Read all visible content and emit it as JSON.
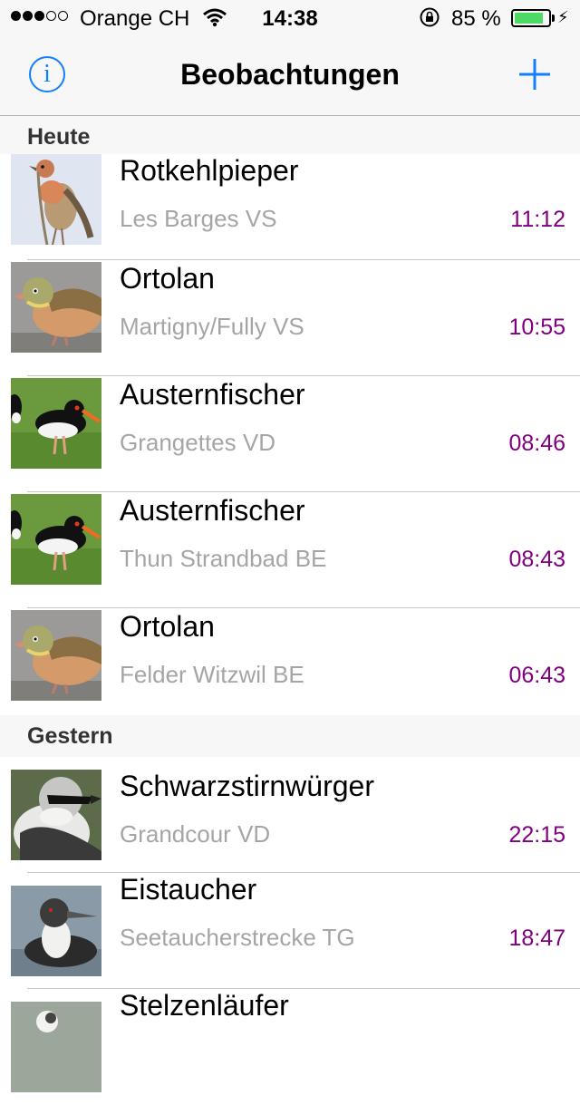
{
  "status_bar": {
    "carrier": "Orange CH",
    "time": "14:38",
    "battery_percent": "85 %",
    "battery_level": 0.85,
    "signal_bars_filled": 3,
    "signal_bars_total": 5,
    "icons": [
      "signal-dots-icon",
      "wifi-icon",
      "rotation-lock-icon",
      "battery-icon",
      "charging-bolt-icon"
    ]
  },
  "nav": {
    "title": "Beobachtungen",
    "info_icon": "info-icon",
    "info_glyph": "i",
    "add_icon": "plus-icon"
  },
  "colors": {
    "accent_blue": "#147efb",
    "time_purple": "#800080",
    "location_gray": "#a5a5a5",
    "battery_green": "#4cd964",
    "header_bg": "#f7f7f7"
  },
  "sections": [
    {
      "title": "Heute",
      "rows": [
        {
          "species": "Rotkehlpieper",
          "location": "Les Barges VS",
          "time": "11:12",
          "photo": "pipit"
        },
        {
          "species": "Ortolan",
          "location": "Martigny/Fully VS",
          "time": "10:55",
          "photo": "bunting"
        },
        {
          "species": "Austernfischer",
          "location": "Grangettes VD",
          "time": "08:46",
          "photo": "oystercatcher"
        },
        {
          "species": "Austernfischer",
          "location": "Thun Strandbad BE",
          "time": "08:43",
          "photo": "oystercatcher"
        },
        {
          "species": "Ortolan",
          "location": "Felder Witzwil BE",
          "time": "06:43",
          "photo": "bunting"
        }
      ]
    },
    {
      "title": "Gestern",
      "rows": [
        {
          "species": "Schwarzstirnwürger",
          "location": "Grandcour VD",
          "time": "22:15",
          "photo": "shrike"
        },
        {
          "species": "Eistaucher",
          "location": "Seetaucherstrecke TG",
          "time": "18:47",
          "photo": "loon"
        },
        {
          "species": "Stelzenläufer",
          "location": "",
          "time": "",
          "photo": "stilt"
        }
      ]
    }
  ]
}
